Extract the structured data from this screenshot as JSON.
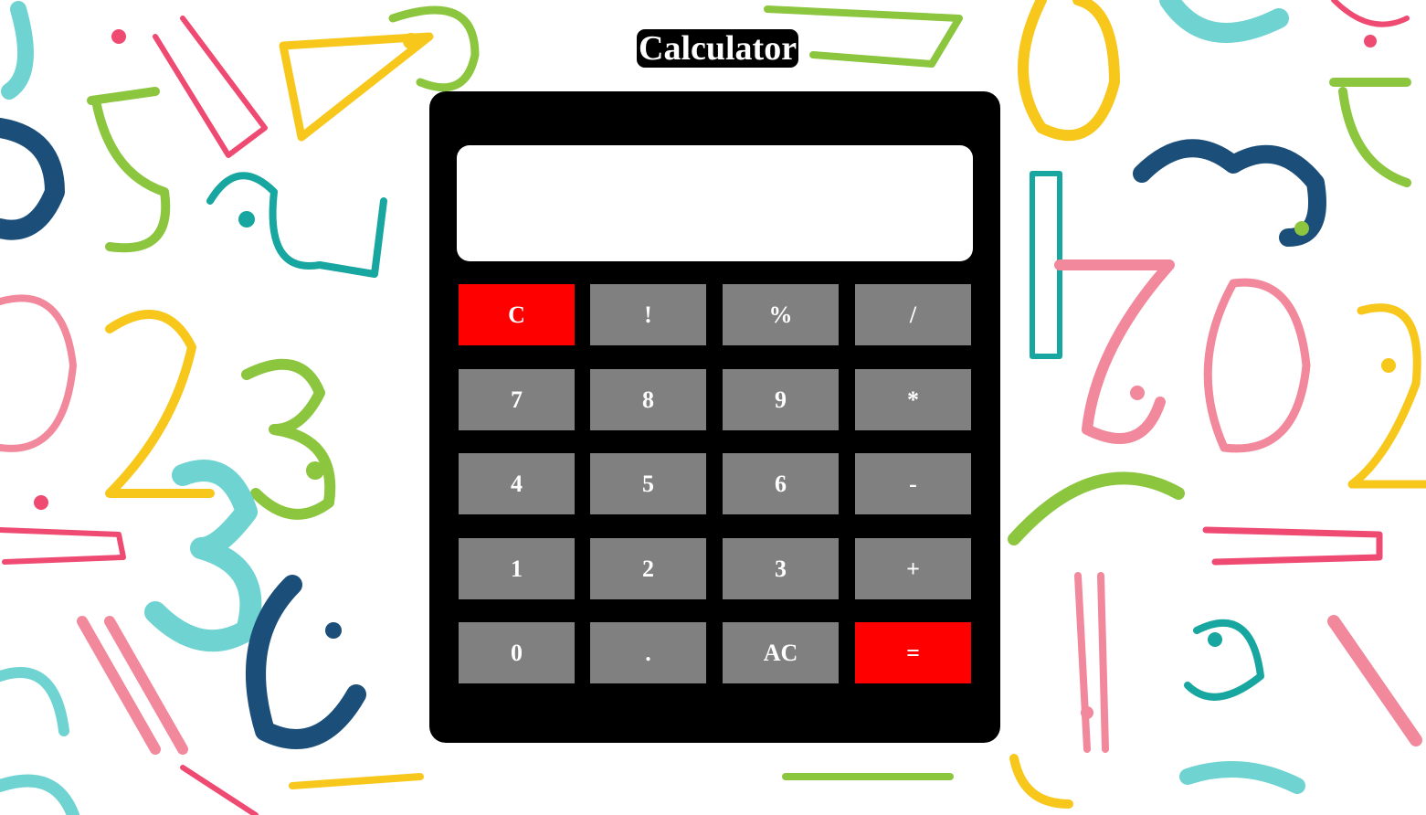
{
  "app": {
    "title": "Calculator"
  },
  "display": {
    "value": ""
  },
  "keys": [
    {
      "label": "C",
      "type": "clear"
    },
    {
      "label": "!",
      "type": "operator"
    },
    {
      "label": "%",
      "type": "operator"
    },
    {
      "label": "/",
      "type": "operator"
    },
    {
      "label": "7",
      "type": "digit"
    },
    {
      "label": "8",
      "type": "digit"
    },
    {
      "label": "9",
      "type": "digit"
    },
    {
      "label": "*",
      "type": "operator"
    },
    {
      "label": "4",
      "type": "digit"
    },
    {
      "label": "5",
      "type": "digit"
    },
    {
      "label": "6",
      "type": "digit"
    },
    {
      "label": "-",
      "type": "operator"
    },
    {
      "label": "1",
      "type": "digit"
    },
    {
      "label": "2",
      "type": "digit"
    },
    {
      "label": "3",
      "type": "digit"
    },
    {
      "label": "+",
      "type": "operator"
    },
    {
      "label": "0",
      "type": "digit"
    },
    {
      "label": ".",
      "type": "digit"
    },
    {
      "label": "AC",
      "type": "clear-all"
    },
    {
      "label": "=",
      "type": "equals"
    }
  ],
  "colors": {
    "calculator_body": "#000000",
    "display_bg": "#ffffff",
    "key_default": "#808080",
    "key_accent": "#ff0000",
    "key_text": "#ffffff"
  },
  "background": {
    "pattern": "hand-drawn-colorful-numerals",
    "numerals": [
      "0",
      "1",
      "2",
      "3",
      "4",
      "5",
      "6",
      "7",
      "9"
    ]
  }
}
